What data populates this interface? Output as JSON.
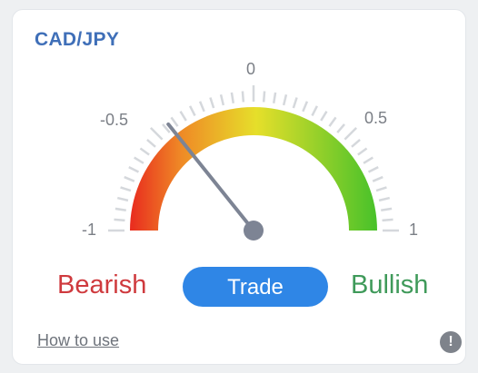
{
  "widget": {
    "pair": "CAD/JPY",
    "gauge": {
      "min_label": "-1",
      "neg_half_label": "-0.5",
      "zero_label": "0",
      "pos_half_label": "0.5",
      "max_label": "1",
      "value": -0.43,
      "colors": {
        "red": "#e8241e",
        "orange": "#ef8a26",
        "yellow": "#e6df2a",
        "green": "#49c22a",
        "needle": "#7d8494",
        "ticks": "#d5d8dc"
      }
    },
    "bearish_label": "Bearish",
    "trade_label": "Trade",
    "bullish_label": "Bullish",
    "how_to_use_label": "How to use",
    "info_icon": "exclamation-info-icon",
    "info_glyph": "!"
  }
}
